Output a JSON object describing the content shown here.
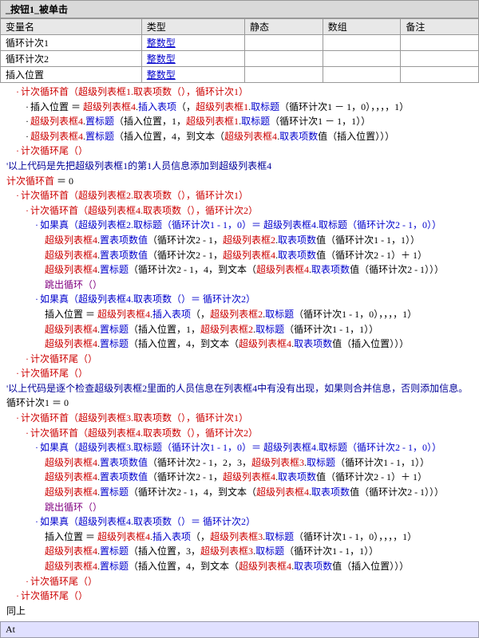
{
  "header": {
    "title": "_按钮1_被单击"
  },
  "var_table": {
    "headers": [
      "变量名",
      "类型",
      "静态",
      "数组",
      "备注"
    ],
    "rows": [
      [
        "循环计次1",
        "整数型",
        "",
        "",
        ""
      ],
      [
        "循环计次2",
        "整数型",
        "",
        "",
        ""
      ],
      [
        "插入位置",
        "整数型",
        "",
        "",
        ""
      ]
    ]
  },
  "code_lines": [
    {
      "indent": 1,
      "prefix": "·",
      "text": "计次循环首（超级列表框1.取表项数（），循环计次1）",
      "color": "red"
    },
    {
      "indent": 2,
      "prefix": "·",
      "text": "插入位置 ＝ 超级列表框4.插入表项（，超级列表框1.取标题（循环计次1 － 1，0），，，，1）",
      "color": "black"
    },
    {
      "indent": 2,
      "prefix": "·",
      "text": "超级列表框4.置标题（插入位置，1，超级列表框1.取标题（循环计次1 － 1，1））",
      "color": "black"
    },
    {
      "indent": 2,
      "prefix": "·",
      "text": "超级列表框4.置标题（插入位置，4，到文本（超级列表框4.取表项数值（插入位置）））",
      "color": "black"
    },
    {
      "indent": 1,
      "prefix": "·",
      "text": "计次循环尾（）",
      "color": "red"
    },
    {
      "indent": 0,
      "prefix": "'",
      "text": "以上代码是先把超级列表框1的第1人员信息添加到超级列表框4",
      "color": "comment"
    },
    {
      "indent": 0,
      "prefix": " ",
      "text": "计次循环首 ＝ 0",
      "color": "black"
    },
    {
      "indent": 1,
      "prefix": "·",
      "text": "计次循环首（超级列表框2.取表项数（），循环计次1）",
      "color": "red"
    },
    {
      "indent": 2,
      "prefix": "·",
      "text": "计次循环首（超级列表框4.取表项数（），循环计次2）",
      "color": "red"
    },
    {
      "indent": 3,
      "prefix": "·",
      "text": "如果真（超级列表框2.取标题（循环计次1 - 1，0）＝ 超级列表框4.取标题（循环计次2 - 1，0））",
      "color": "blue"
    },
    {
      "indent": 4,
      "prefix": " ",
      "text": "超级列表框4.置表项数值（循环计次2 - 1，超级列表框2.取表项数值（循环计次1 - 1，1））",
      "color": "black"
    },
    {
      "indent": 4,
      "prefix": " ",
      "text": "超级列表框4.置表项数值（循环计次2 - 1，超级列表框4.取表项数值（循环计次2 - 1）＋ 1）",
      "color": "black"
    },
    {
      "indent": 4,
      "prefix": " ",
      "text": "超级列表框4.置标题（循环计次2 - 1，4，到文本（超级列表框4.取表项数值（循环计次2 - 1）））",
      "color": "black"
    },
    {
      "indent": 4,
      "prefix": " ",
      "text": "跳出循环（）",
      "color": "purple"
    },
    {
      "indent": 3,
      "prefix": " ",
      "text": "",
      "color": "black"
    },
    {
      "indent": 3,
      "prefix": "·",
      "text": "如果真（超级列表框4.取表项数（）＝ 循环计次2）",
      "color": "blue"
    },
    {
      "indent": 4,
      "prefix": " ",
      "text": "插入位置 ＝ 超级列表框4.插入表项（，超级列表框2.取标题（循环计次1 - 1，0），，，，1）",
      "color": "black"
    },
    {
      "indent": 4,
      "prefix": " ",
      "text": "超级列表框4.置标题（插入位置，1，超级列表框2.取标题（循环计次1 - 1，1））",
      "color": "black"
    },
    {
      "indent": 4,
      "prefix": " ",
      "text": "超级列表框4.置标题（插入位置，4，到文本（超级列表框4.取表项数值（插入位置）））",
      "color": "black"
    },
    {
      "indent": 2,
      "prefix": "·",
      "text": "计次循环尾（）",
      "color": "red"
    },
    {
      "indent": 1,
      "prefix": "·",
      "text": "计次循环尾（）",
      "color": "red"
    },
    {
      "indent": 0,
      "prefix": "'",
      "text": "以上代码是逐个检查超级列表框2里面的人员信息在列表框4中有没有出现，如果则合并信息，否则添加信息。",
      "color": "comment"
    },
    {
      "indent": 0,
      "prefix": " ",
      "text": "循环计次1 ＝ 0",
      "color": "black"
    },
    {
      "indent": 1,
      "prefix": "·",
      "text": "计次循环首（超级列表框3.取表项数（），循环计次1）",
      "color": "red"
    },
    {
      "indent": 2,
      "prefix": "·",
      "text": "计次循环首（超级列表框4.取表项数（），循环计次2）",
      "color": "red"
    },
    {
      "indent": 3,
      "prefix": "·",
      "text": "如果真（超级列表框3.取标题（循环计次1 - 1，0）＝ 超级列表框4.取标题（循环计次2 - 1，0））",
      "color": "blue"
    },
    {
      "indent": 4,
      "prefix": " ",
      "text": "超级列表框4.置表项数值（循环计次2 - 1，2，3，超级列表框3.取标题（循环计次1 - 1，1））",
      "color": "black"
    },
    {
      "indent": 4,
      "prefix": " ",
      "text": "超级列表框4.置表项数值（循环计次2 - 1，超级列表框4.取表项数值（循环计次2 - 1）＋ 1）",
      "color": "black"
    },
    {
      "indent": 4,
      "prefix": " ",
      "text": "超级列表框4.置标题（循环计次2 - 1，4，到文本（超级列表框4.取表项数值（循环计次2 - 1）））",
      "color": "black"
    },
    {
      "indent": 4,
      "prefix": " ",
      "text": "跳出循环（）",
      "color": "purple"
    },
    {
      "indent": 3,
      "prefix": " ",
      "text": "",
      "color": "black"
    },
    {
      "indent": 3,
      "prefix": "·",
      "text": "如果真（超级列表框4.取表项数（）＝ 循环计次2）",
      "color": "blue"
    },
    {
      "indent": 4,
      "prefix": " ",
      "text": "插入位置 ＝ 超级列表框4.插入表项（，超级列表框3.取标题（循环计次1 - 1，0），，，，1）",
      "color": "black"
    },
    {
      "indent": 4,
      "prefix": " ",
      "text": "超级列表框4.置标题（插入位置，3，超级列表框3.取标题（循环计次1 - 1，1））",
      "color": "black"
    },
    {
      "indent": 4,
      "prefix": " ",
      "text": "超级列表框4.置标题（插入位置，4，到文本（超级列表框4.取表项数值（插入位置）））",
      "color": "black"
    },
    {
      "indent": 2,
      "prefix": "·",
      "text": "计次循环尾（）",
      "color": "red"
    },
    {
      "indent": 1,
      "prefix": "·",
      "text": "计次循环尾（）",
      "color": "red"
    },
    {
      "indent": 0,
      "prefix": " ",
      "text": "同上",
      "color": "black"
    }
  ],
  "bottom": {
    "text": "At"
  }
}
